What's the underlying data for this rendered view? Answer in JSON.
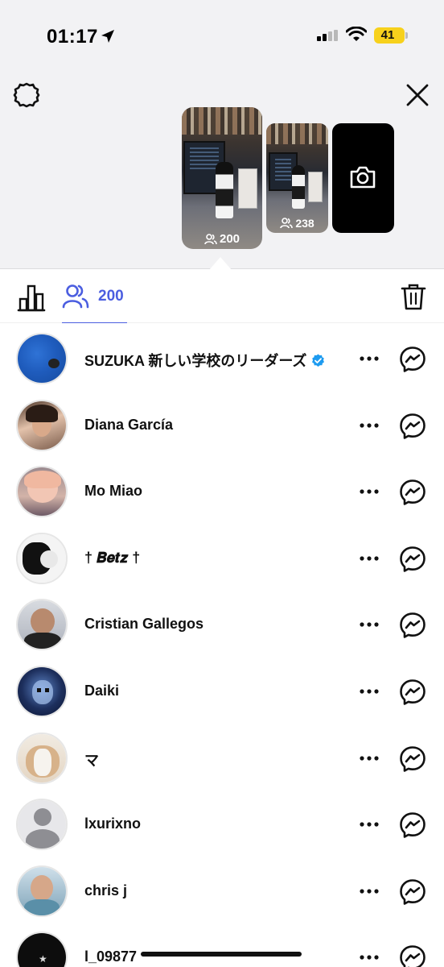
{
  "status_bar": {
    "time": "01:17",
    "battery": "41",
    "icons": [
      "location-arrow-icon",
      "cellular-signal-icon",
      "wifi-icon",
      "battery-icon"
    ]
  },
  "header": {
    "icons": [
      "gear-icon",
      "close-icon"
    ]
  },
  "stories": [
    {
      "viewer_count": "200",
      "icon": "viewers-icon"
    },
    {
      "viewer_count": "238",
      "icon": "viewers-icon"
    },
    {
      "icon": "camera-icon"
    }
  ],
  "tabs": {
    "viewers_count": "200",
    "icons": [
      "bar-chart-icon",
      "viewers-icon",
      "trash-icon"
    ],
    "accent_color": "#4b5ee0"
  },
  "viewers": [
    {
      "name": "SUZUKA 新しい学校のリーダーズ",
      "verified": true
    },
    {
      "name": "Diana García",
      "verified": false
    },
    {
      "name": "Mo Miao",
      "verified": false
    },
    {
      "name": "† 𝑩𝒆𝒕𝒛 †",
      "verified": false
    },
    {
      "name": "Cristian Gallegos",
      "verified": false
    },
    {
      "name": "Daiki",
      "verified": false
    },
    {
      "name": "マ",
      "verified": false
    },
    {
      "name": "lxurixno",
      "verified": false
    },
    {
      "name": "chris j",
      "verified": false
    },
    {
      "name": "l_09877",
      "verified": false
    }
  ],
  "row_icons": [
    "more-options-icon",
    "messenger-icon"
  ],
  "colors": {
    "top_background": "#f2f2f4",
    "verified_blue": "#1d9bf0",
    "battery_yellow": "#f7d11c"
  }
}
